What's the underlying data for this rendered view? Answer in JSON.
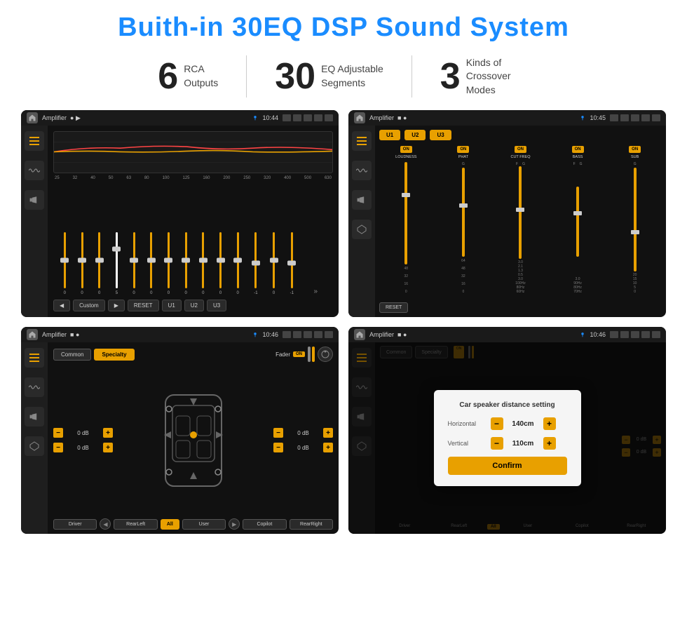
{
  "page": {
    "title": "Buith-in 30EQ DSP Sound System",
    "stats": [
      {
        "number": "6",
        "label": "RCA\nOutputs"
      },
      {
        "number": "30",
        "label": "EQ Adjustable\nSegments"
      },
      {
        "number": "3",
        "label": "Kinds of\nCrossover Modes"
      }
    ],
    "screens": [
      {
        "id": "screen1",
        "statusBar": {
          "title": "Amplifier",
          "time": "10:44"
        },
        "type": "eq"
      },
      {
        "id": "screen2",
        "statusBar": {
          "title": "Amplifier",
          "time": "10:45"
        },
        "type": "crossover"
      },
      {
        "id": "screen3",
        "statusBar": {
          "title": "Amplifier",
          "time": "10:46"
        },
        "type": "speaker"
      },
      {
        "id": "screen4",
        "statusBar": {
          "title": "Amplifier",
          "time": "10:46"
        },
        "type": "distance-dialog"
      }
    ],
    "eq": {
      "freqs": [
        "25",
        "32",
        "40",
        "50",
        "63",
        "80",
        "100",
        "125",
        "160",
        "200",
        "250",
        "320",
        "400",
        "500",
        "630"
      ],
      "values": [
        "0",
        "0",
        "0",
        "5",
        "0",
        "0",
        "0",
        "0",
        "0",
        "0",
        "0",
        "-1",
        "0",
        "-1"
      ],
      "presets": [
        "Custom"
      ],
      "buttons": [
        "RESET",
        "U1",
        "U2",
        "U3"
      ]
    },
    "crossover": {
      "presets": [
        "U1",
        "U2",
        "U3"
      ],
      "channels": [
        "LOUDNESS",
        "PHAT",
        "CUT FREQ",
        "BASS",
        "SUB"
      ],
      "reset": "RESET"
    },
    "speaker": {
      "tabs": [
        "Common",
        "Specialty"
      ],
      "fader": "Fader",
      "faderOn": "ON",
      "positions": [
        "Driver",
        "Copilot",
        "RearLeft",
        "All",
        "User",
        "RearRight"
      ],
      "dbValues": [
        "0 dB",
        "0 dB",
        "0 dB",
        "0 dB"
      ]
    },
    "dialog": {
      "title": "Car speaker distance setting",
      "horizontal": {
        "label": "Horizontal",
        "value": "140cm"
      },
      "vertical": {
        "label": "Vertical",
        "value": "110cm"
      },
      "confirmLabel": "Confirm"
    }
  }
}
